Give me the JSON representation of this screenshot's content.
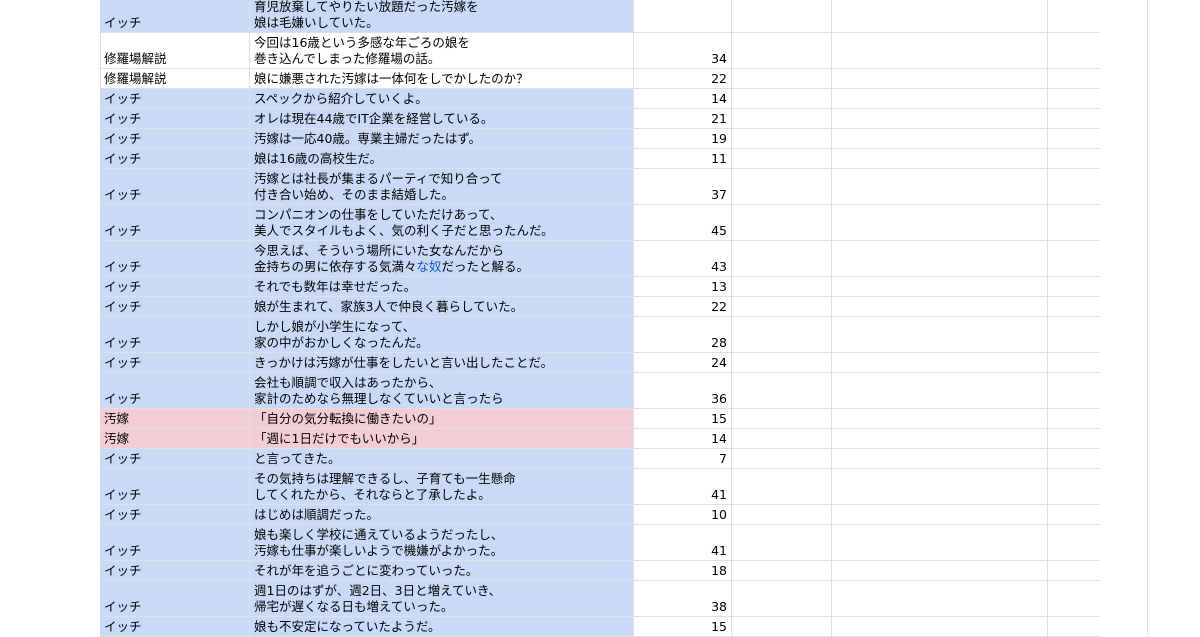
{
  "sheet": {
    "rows": [
      {
        "speaker": "イッチ",
        "lines": [
          "育児放棄してやりたい放題だった汚嫁を",
          "娘は毛嫌いしていた。"
        ],
        "count": "",
        "highlight": "blue"
      },
      {
        "speaker": "修羅場解説",
        "lines": [
          "今回は16歳という多感な年ごろの娘を",
          "巻き込んでしまった修羅場の話。"
        ],
        "count": "34",
        "highlight": "none"
      },
      {
        "speaker": "修羅場解説",
        "lines": [
          "娘に嫌悪された汚嫁は一体何をしでかしたのか？"
        ],
        "count": "22",
        "highlight": "none"
      },
      {
        "speaker": "イッチ",
        "lines": [
          "スペックから紹介していくよ。"
        ],
        "count": "14",
        "highlight": "blue"
      },
      {
        "speaker": "イッチ",
        "lines": [
          "オレは現在44歳でIT企業を経営している。"
        ],
        "count": "21",
        "highlight": "blue"
      },
      {
        "speaker": "イッチ",
        "lines": [
          "汚嫁は一応40歳。専業主婦だったはず。"
        ],
        "count": "19",
        "highlight": "blue"
      },
      {
        "speaker": "イッチ",
        "lines": [
          "娘は16歳の高校生だ。"
        ],
        "count": "11",
        "highlight": "blue"
      },
      {
        "speaker": "イッチ",
        "lines": [
          "汚嫁とは社長が集まるパーティで知り合って",
          "付き合い始め、そのまま結婚した。"
        ],
        "count": "37",
        "highlight": "blue"
      },
      {
        "speaker": "イッチ",
        "lines": [
          "コンパニオンの仕事をしていただけあって、",
          "美人でスタイルもよく、気の利く子だと思ったんだ。"
        ],
        "count": "45",
        "highlight": "blue"
      },
      {
        "speaker": "イッチ",
        "lines": [
          "今思えば、そういう場所にいた女なんだから",
          "金持ちの男に依存する気満々な奴だったと解る。"
        ],
        "count": "43",
        "highlight": "blue",
        "link_segment": {
          "line": 1,
          "before": "金持ちの男に依存する気満々",
          "link": "な奴",
          "after": "だったと解る。"
        }
      },
      {
        "speaker": "イッチ",
        "lines": [
          "それでも数年は幸せだった。"
        ],
        "count": "13",
        "highlight": "blue"
      },
      {
        "speaker": "イッチ",
        "lines": [
          "娘が生まれて、家族3人で仲良く暮らしていた。"
        ],
        "count": "22",
        "highlight": "blue"
      },
      {
        "speaker": "イッチ",
        "lines": [
          "しかし娘が小学生になって、",
          "家の中がおかしくなったんだ。"
        ],
        "count": "28",
        "highlight": "blue"
      },
      {
        "speaker": "イッチ",
        "lines": [
          "きっかけは汚嫁が仕事をしたいと言い出したことだ。"
        ],
        "count": "24",
        "highlight": "blue"
      },
      {
        "speaker": "イッチ",
        "lines": [
          "会社も順調で収入はあったから、",
          "家計のためなら無理しなくていいと言ったら"
        ],
        "count": "36",
        "highlight": "blue"
      },
      {
        "speaker": "汚嫁",
        "lines": [
          "「自分の気分転換に働きたいの」"
        ],
        "count": "15",
        "highlight": "pink"
      },
      {
        "speaker": "汚嫁",
        "lines": [
          "「週に1日だけでもいいから」"
        ],
        "count": "14",
        "highlight": "pink"
      },
      {
        "speaker": "イッチ",
        "lines": [
          "と言ってきた。"
        ],
        "count": "7",
        "highlight": "blue"
      },
      {
        "speaker": "イッチ",
        "lines": [
          "その気持ちは理解できるし、子育ても一生懸命",
          "してくれたから、それならと了承したよ。"
        ],
        "count": "41",
        "highlight": "blue"
      },
      {
        "speaker": "イッチ",
        "lines": [
          "はじめは順調だった。"
        ],
        "count": "10",
        "highlight": "blue"
      },
      {
        "speaker": "イッチ",
        "lines": [
          "娘も楽しく学校に通えているようだったし、",
          "汚嫁も仕事が楽しいようで機嫌がよかった。"
        ],
        "count": "41",
        "highlight": "blue"
      },
      {
        "speaker": "イッチ",
        "lines": [
          "それが年を追うごとに変わっていった。"
        ],
        "count": "18",
        "highlight": "blue"
      },
      {
        "speaker": "イッチ",
        "lines": [
          "週1日のはずが、週2日、3日と増えていき、",
          "帰宅が遅くなる日も増えていった。"
        ],
        "count": "38",
        "highlight": "blue"
      },
      {
        "speaker": "イッチ",
        "lines": [
          "娘も不安定になっていたようだ。"
        ],
        "count": "15",
        "highlight": "blue"
      }
    ]
  },
  "colors": {
    "highlight_blue": "#c9daf8",
    "highlight_pink": "#f4ccd5",
    "grid": "#e0e0e0",
    "link": "#1155cc"
  }
}
